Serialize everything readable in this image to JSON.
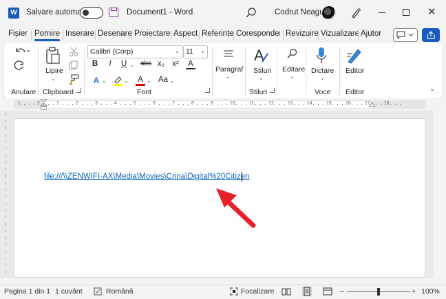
{
  "titlebar": {
    "app_logo": "W",
    "autosave_label": "Salvare automată",
    "autosave_on": false,
    "document_title": "Document1  -  Word",
    "user_name": "Codrut Neagu",
    "icons": [
      "word-logo",
      "toggle",
      "save-icon",
      "search-icon",
      "avatar",
      "pen-icon",
      "minimize-icon",
      "maximize-icon",
      "close-icon"
    ],
    "close_glyph": "✕"
  },
  "tabs": [
    "Fișier",
    "Pornire",
    "Inserare",
    "Desenare",
    "Proiectare",
    "Aspect",
    "Referințe",
    "Corespondența",
    "Revizuire",
    "Vizualizare",
    "Ajutor"
  ],
  "active_tab": "Pornire",
  "ribbon": {
    "groups": {
      "undo": "Anulare",
      "clipboard": "Clipboard",
      "font": "Font",
      "styles": "Stiluri",
      "voice": "Voce",
      "editor": "Editor"
    },
    "paste_label": "Lipire",
    "font_name": "Calibri (Corp)",
    "font_size": "11",
    "paragraph_label": "Paragraf",
    "styles_label": "Stiluri",
    "editing_label": "Editare",
    "dictate_label": "Dictare",
    "editor_label": "Editor",
    "format_buttons": [
      "B",
      "I",
      "U",
      "abc",
      "x₂",
      "x²",
      "A"
    ],
    "format_buttons_row2": [
      "A",
      "A",
      "Aa"
    ],
    "accent_color": "#185abd"
  },
  "document": {
    "hyperlink_text": "file:///\\\\ZENWIFI-AX\\Media\\Movies\\Crina\\Digital%20Citizen",
    "link_color": "#0563c1",
    "annotation_color": "#e8202a"
  },
  "ruler": {
    "numbers": [
      "1",
      "2",
      "1",
      "2",
      "3",
      "4",
      "5",
      "6",
      "7",
      "8",
      "9",
      "10",
      "11",
      "12",
      "13",
      "14",
      "15",
      "16",
      "17",
      "18"
    ]
  },
  "statusbar": {
    "page": "Pagina 1 din 1",
    "words": "1 cuvânt",
    "language": "Română",
    "focus": "Focalizare",
    "zoom": "100%",
    "zoom_minus": "–",
    "zoom_plus": "+"
  }
}
